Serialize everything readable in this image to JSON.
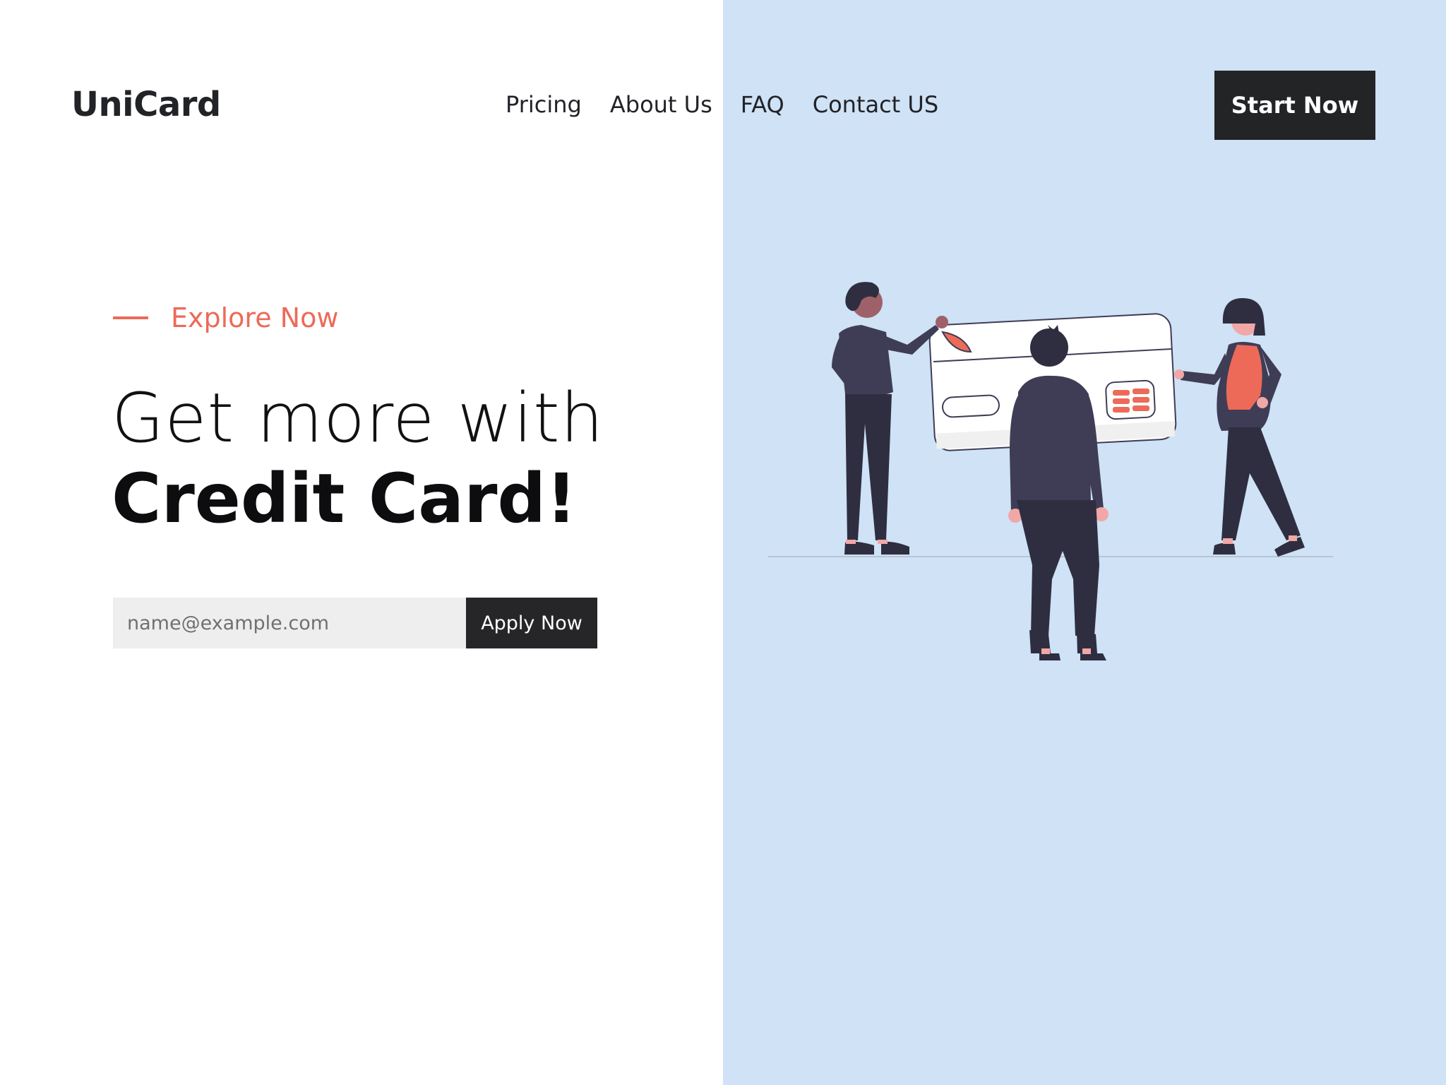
{
  "header": {
    "logo": "UniCard",
    "nav": [
      "Pricing",
      "About Us",
      "FAQ",
      "Contact US"
    ],
    "cta_label": "Start Now"
  },
  "hero": {
    "kicker": "Explore Now",
    "headline_light": "Get more with",
    "headline_bold": "Credit Card!",
    "email_placeholder": "name@example.com",
    "apply_label": "Apply Now"
  },
  "colors": {
    "accent": "#ed6a59",
    "dark": "#232426",
    "panel": "#cfe2f6"
  },
  "illustration": {
    "name": "people-with-credit-card-illustration"
  }
}
